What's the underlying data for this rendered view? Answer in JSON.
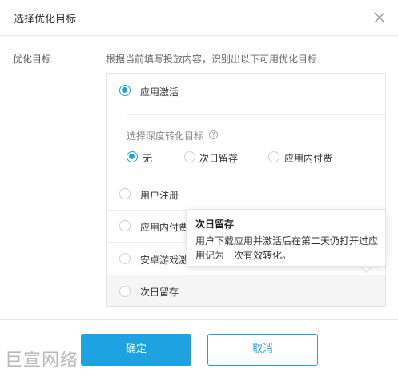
{
  "dialog": {
    "title": "选择优化目标"
  },
  "form": {
    "label": "优化目标",
    "hint": "根据当前填写投放内容，识别出以下可用优化目标"
  },
  "options": {
    "app_activation": "应用激活",
    "deep_conversion_title": "选择深度转化目标",
    "deep_none": "无",
    "deep_next_day_retention": "次日留存",
    "deep_in_app_payment": "应用内付费",
    "user_registration": "用户注册",
    "in_app_payment": "应用内付费",
    "android_game_activation": "安卓游戏激",
    "next_day_retention": "次日留存"
  },
  "tooltip": {
    "title": "次日留存",
    "body": "用户下载应用并激活后在第二天仍打开过应用记为一次有效转化。"
  },
  "buttons": {
    "confirm": "确定",
    "cancel": "取消"
  },
  "watermark": "巨宣网络",
  "colors": {
    "accent": "#1fa3e0",
    "border": "#e3e3e3",
    "hover_bg": "#f5f5f5"
  }
}
